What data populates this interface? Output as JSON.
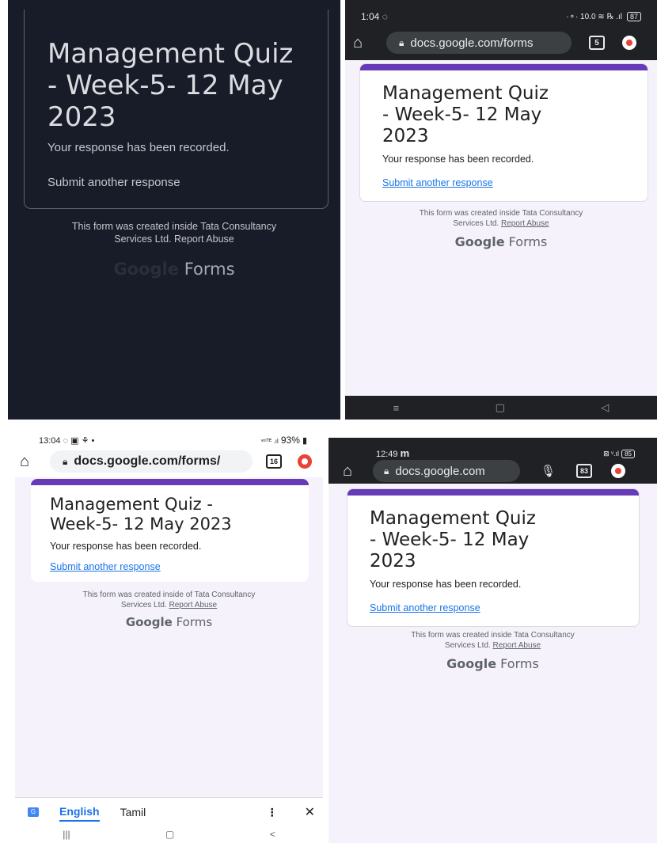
{
  "form": {
    "title_wrapped_3": [
      "Management Quiz",
      "- Week-5- 12 May",
      "2023"
    ],
    "title_wrapped_2": [
      "Management Quiz -",
      "Week-5- 12 May 2023"
    ],
    "response_recorded": "Your response has been recorded.",
    "submit_another": "Submit another response",
    "footer_line1": "This form was created inside Tata Consultancy",
    "footer_line2_prefix": "Services Ltd.",
    "footer_line1_alt": "This form was created inside of Tata Consultancy",
    "report_abuse": "Report Abuse",
    "brand_google": "Google",
    "brand_forms": "Forms"
  },
  "panel2": {
    "time": "1:04",
    "status_icons": "·⚬· 10.0 ≋ ℞ .ıl",
    "battery": "87",
    "url": "docs.google.com/forms",
    "tab_count": "5"
  },
  "panel3": {
    "time": "13:04",
    "status_icons": "ᵛᵒˡᵀᴱ .ıl",
    "battery": "93%",
    "url": "docs.google.com/forms/",
    "tab_count": "16",
    "translate": {
      "lang1": "English",
      "lang2": "Tamil"
    }
  },
  "panel4": {
    "time": "12:49",
    "app_letter": "m",
    "battery": "85",
    "url": "docs.google.com",
    "tab_count": "83"
  },
  "colors": {
    "accent_purple": "#673ab7",
    "link_blue": "#1a73e8",
    "dark_bg": "#181b28",
    "light_bg": "#f5f2fb"
  }
}
